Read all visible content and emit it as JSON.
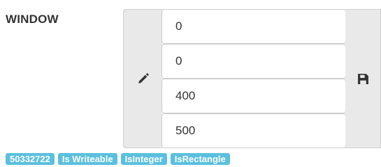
{
  "field": {
    "label": "WINDOW",
    "values": [
      "0",
      "0",
      "400",
      "500"
    ],
    "edit_icon": "pencil-icon",
    "save_icon": "floppy-disk-icon"
  },
  "badges": [
    "50332722",
    "Is Writeable",
    "IsInteger",
    "IsRectangle"
  ],
  "colors": {
    "badge": "#5bc0de",
    "addon_bg": "#e9e9e9",
    "text": "#333333"
  }
}
